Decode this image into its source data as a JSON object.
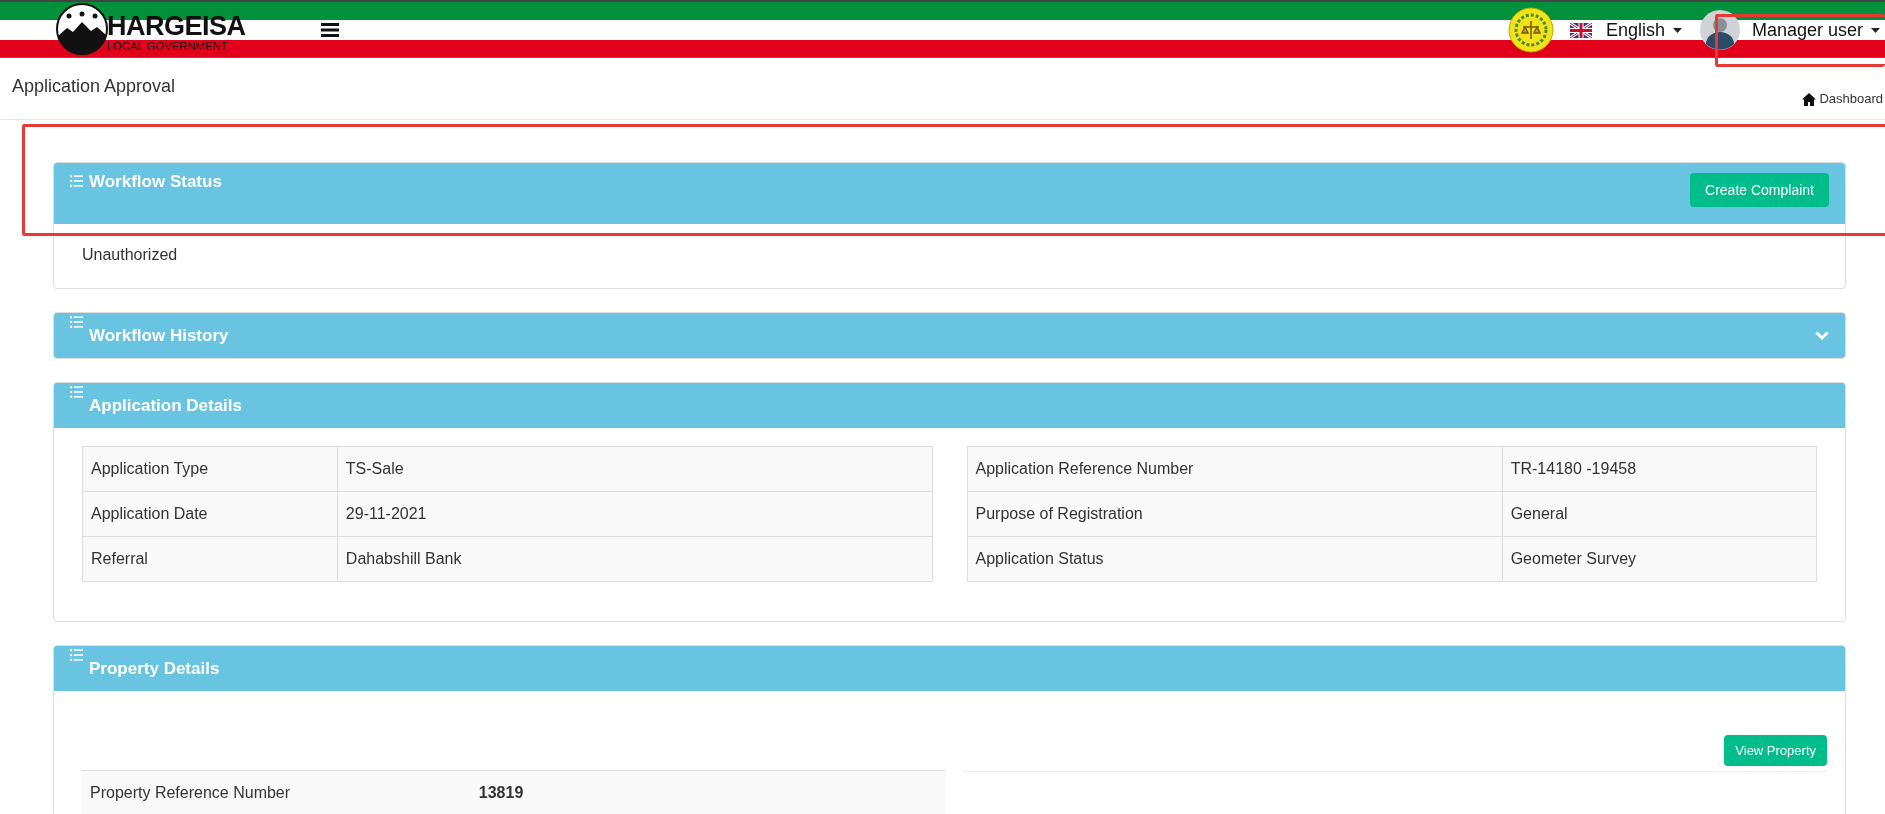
{
  "header": {
    "brand": "HARGEISA",
    "brand_subtitle": "LOCAL GOVERNMENT",
    "language": "English",
    "user": "Manager user",
    "user_highlighted": true
  },
  "page": {
    "title": "Application Approval",
    "breadcrumb": "Dashboard"
  },
  "panels": [
    {
      "kind": "status",
      "title": "Workflow Status",
      "action": "Create Complaint",
      "body": "Unauthorized",
      "highlighted": true
    },
    {
      "kind": "collapsible",
      "title": "Workflow History",
      "expanded": false
    },
    {
      "kind": "details",
      "title": "Application Details",
      "tables": [
        [
          {
            "label": "Application Type",
            "value": "TS-Sale"
          },
          {
            "label": "Application Date",
            "value": "29-11-2021"
          },
          {
            "label": "Referral",
            "value": "Dahabshill Bank"
          }
        ],
        [
          {
            "label": "Application Reference Number",
            "value": "TR-14180 -19458"
          },
          {
            "label": "Purpose of Registration",
            "value": "General"
          },
          {
            "label": "Application Status",
            "value": "Geometer Survey"
          }
        ]
      ]
    },
    {
      "kind": "property",
      "title": "Property Details",
      "action": "View Property",
      "rows": [
        {
          "label": "Property Reference Number",
          "value": "13819"
        }
      ]
    }
  ]
}
